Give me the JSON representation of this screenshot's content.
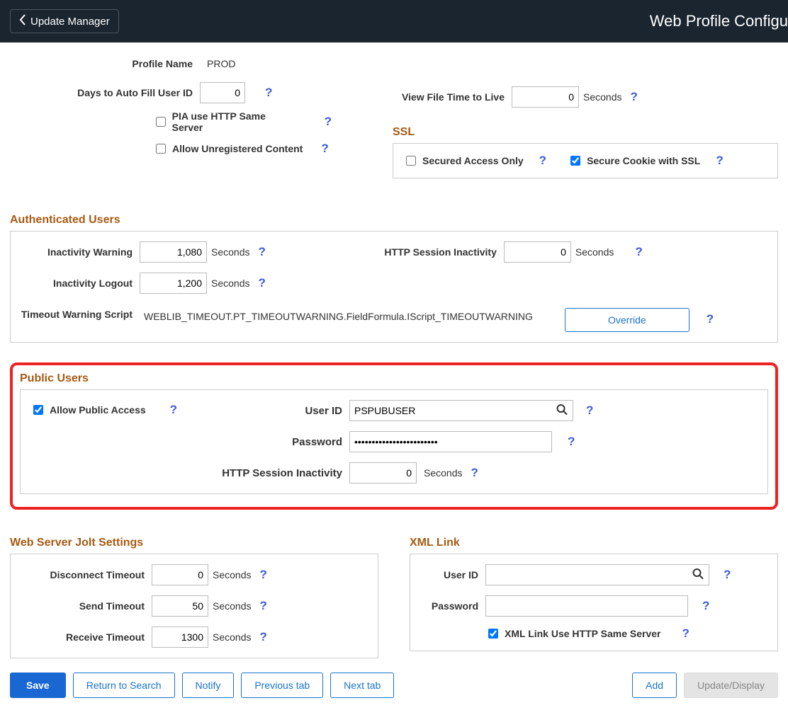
{
  "topbar": {
    "back_label": "Update Manager",
    "page_title": "Web Profile Configu"
  },
  "profile": {
    "name_label": "Profile Name",
    "name_value": "PROD",
    "days_autofill_label": "Days to Auto Fill User ID",
    "days_autofill_value": "0",
    "pia_http_label": "PIA use HTTP Same Server",
    "pia_http_checked": false,
    "allow_unreg_label": "Allow Unregistered Content",
    "allow_unreg_checked": false,
    "view_file_ttl_label": "View File Time to Live",
    "view_file_ttl_value": "0",
    "seconds_label": "Seconds"
  },
  "ssl": {
    "title": "SSL",
    "secured_access_label": "Secured Access Only",
    "secured_access_checked": false,
    "secure_cookie_label": "Secure Cookie with SSL",
    "secure_cookie_checked": true
  },
  "auth": {
    "title": "Authenticated Users",
    "inactivity_warning_label": "Inactivity Warning",
    "inactivity_warning_value": "1,080",
    "inactivity_logout_label": "Inactivity Logout",
    "inactivity_logout_value": "1,200",
    "http_session_label": "HTTP Session Inactivity",
    "http_session_value": "0",
    "timeout_script_label": "Timeout Warning Script",
    "timeout_script_value": "WEBLIB_TIMEOUT.PT_TIMEOUTWARNING.FieldFormula.IScript_TIMEOUTWARNING",
    "override_label": "Override",
    "seconds_label": "Seconds"
  },
  "public": {
    "title": "Public Users",
    "allow_public_label": "Allow Public Access",
    "allow_public_checked": true,
    "user_id_label": "User ID",
    "user_id_value": "PSPUBUSER",
    "password_label": "Password",
    "password_value": "••••••••••••••••••••••••",
    "http_session_label": "HTTP Session Inactivity",
    "http_session_value": "0",
    "seconds_label": "Seconds"
  },
  "jolt": {
    "title": "Web Server Jolt Settings",
    "disconnect_label": "Disconnect Timeout",
    "disconnect_value": "0",
    "send_label": "Send Timeout",
    "send_value": "50",
    "receive_label": "Receive Timeout",
    "receive_value": "1300",
    "seconds_label": "Seconds"
  },
  "xml": {
    "title": "XML Link",
    "user_id_label": "User ID",
    "user_id_value": "",
    "password_label": "Password",
    "password_value": "",
    "use_http_label": "XML Link Use HTTP Same Server",
    "use_http_checked": true
  },
  "buttons": {
    "save": "Save",
    "return": "Return to Search",
    "notify": "Notify",
    "prev_tab": "Previous tab",
    "next_tab": "Next tab",
    "add": "Add",
    "update": "Update/Display"
  }
}
